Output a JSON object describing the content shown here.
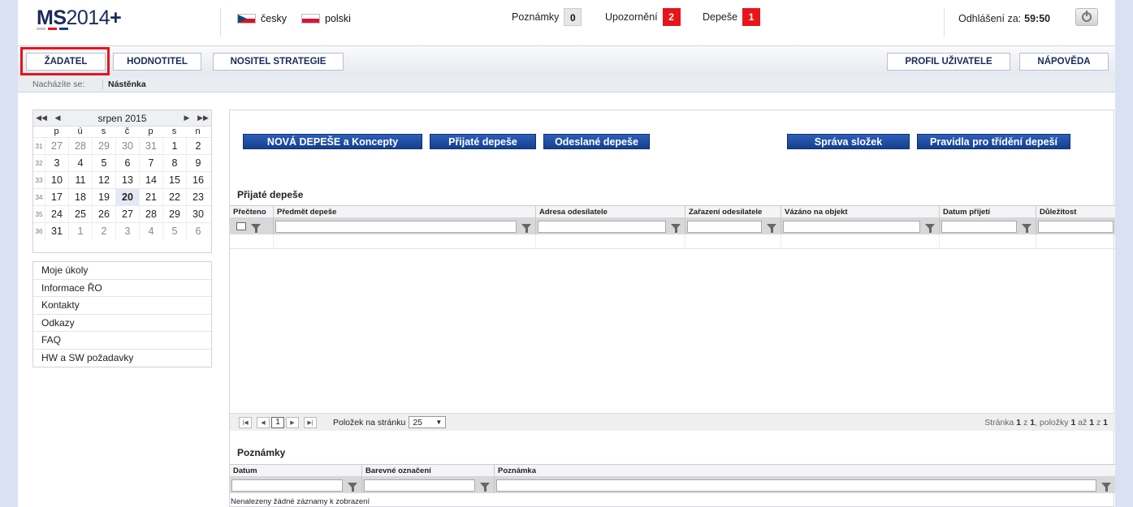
{
  "header": {
    "logo_bold": "MS",
    "logo_light": "2014",
    "logo_plus": "+",
    "languages": [
      {
        "label": "česky",
        "flag": "flag-cz"
      },
      {
        "label": "polski",
        "flag": "flag-pl"
      }
    ],
    "counters": [
      {
        "label": "Poznámky",
        "value": "0",
        "color": "#e6e6e6"
      },
      {
        "label": "Upozornění",
        "value": "2",
        "color": "#e8141a"
      },
      {
        "label": "Depeše",
        "value": "1",
        "color": "#e8141a"
      }
    ],
    "logout_label": "Odhlášení za:",
    "logout_time": "59:50"
  },
  "nav": {
    "left": [
      "ŽADATEL",
      "HODNOTITEL",
      "NOSITEL STRATEGIE"
    ],
    "right": [
      "PROFIL UŽIVATELE",
      "NÁPOVĚDA"
    ],
    "active": "ŽADATEL",
    "highlight_color": "#e8141a"
  },
  "breadcrumb": {
    "label": "Nacházíte se:",
    "current": "Nástěnka"
  },
  "calendar": {
    "month": "srpen 2015",
    "nav": [
      "◀◀",
      "◀",
      "▶",
      "▶▶"
    ],
    "days": [
      "p",
      "ú",
      "s",
      "č",
      "p",
      "s",
      "n"
    ],
    "weeks": [
      {
        "no": "31",
        "d": [
          "27",
          "28",
          "29",
          "30",
          "31",
          "1",
          "2"
        ]
      },
      {
        "no": "32",
        "d": [
          "3",
          "4",
          "5",
          "6",
          "7",
          "8",
          "9"
        ]
      },
      {
        "no": "33",
        "d": [
          "10",
          "11",
          "12",
          "13",
          "14",
          "15",
          "16"
        ]
      },
      {
        "no": "34",
        "d": [
          "17",
          "18",
          "19",
          "20",
          "21",
          "22",
          "23"
        ]
      },
      {
        "no": "35",
        "d": [
          "24",
          "25",
          "26",
          "27",
          "28",
          "29",
          "30"
        ]
      },
      {
        "no": "36",
        "d": [
          "31",
          "1",
          "2",
          "3",
          "4",
          "5",
          "6"
        ]
      }
    ],
    "today": "20"
  },
  "side_menu": [
    "Moje úkoly",
    "Informace ŘO",
    "Kontakty",
    "Odkazy",
    "FAQ",
    "HW a SW požadavky"
  ],
  "toolbar": {
    "buttons": [
      "NOVÁ DEPEŠE a Koncepty",
      "Přijaté depeše",
      "Odeslané depeše",
      "Správa složek",
      "Pravidla pro třídění depeší"
    ],
    "color": "#1f4fa6"
  },
  "received": {
    "title": "Přijaté depeše",
    "columns": [
      "Přečteno",
      "Předmět depeše",
      "Adresa odesílatele",
      "Zařazení odesílatele",
      "Vázáno na objekt",
      "Datum přijetí",
      "Důležitost"
    ]
  },
  "pager": {
    "current_page": "1",
    "per_page_label": "Položek na stránku",
    "per_page": "25",
    "info_prefix": "Stránka",
    "page": "1",
    "of": "z",
    "pages": "1",
    "items_label": ", položky",
    "from": "1",
    "to_label": "až",
    "to": "1",
    "total": "1"
  },
  "notes": {
    "title": "Poznámky",
    "columns": [
      "Datum",
      "Barevné označení",
      "Poznámka"
    ],
    "empty": "Nenalezeny žádné záznamy k zobrazení"
  }
}
